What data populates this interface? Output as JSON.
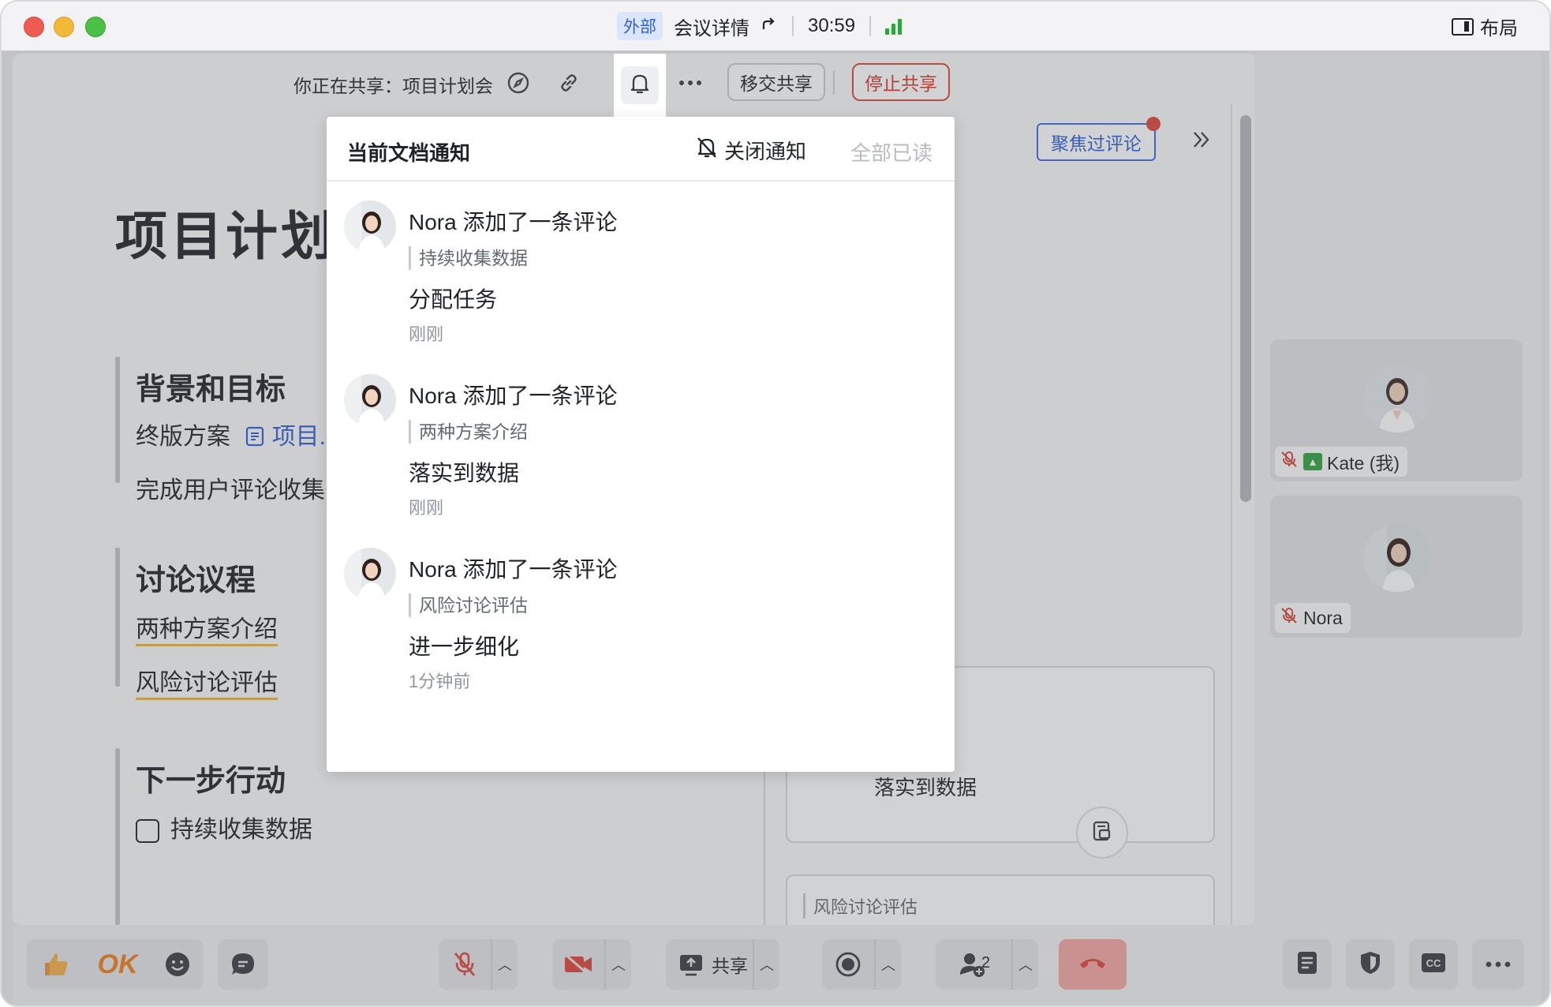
{
  "titlebar": {
    "tag": "外部",
    "meeting_details": "会议详情",
    "timer": "30:59",
    "layout_label": "布局"
  },
  "sharebar": {
    "sharing_text": "你正在共享：项目计划会",
    "transfer_label": "移交共享",
    "stop_label": "停止共享"
  },
  "doc": {
    "title": "项目计划",
    "sections": [
      {
        "heading": "背景和目标",
        "lines": [
          "终版方案",
          "完成用户评论收集"
        ],
        "link": "项目..."
      },
      {
        "heading": "讨论议程",
        "lines": [
          "两种方案介绍",
          "风险讨论评估"
        ]
      },
      {
        "heading": "下一步行动",
        "lines": [
          "持续收集数据"
        ]
      }
    ]
  },
  "comments_panel": {
    "focus_label": "聚焦过评论",
    "card1_text": "落实到数据",
    "card2_quote": "风险讨论评估"
  },
  "popup": {
    "title": "当前文档通知",
    "mute_label": "关闭通知",
    "read_all_label": "全部已读",
    "notifications": [
      {
        "title": "Nora 添加了一条评论",
        "quote": "持续收集数据",
        "body": "分配任务",
        "time": "刚刚"
      },
      {
        "title": "Nora 添加了一条评论",
        "quote": "两种方案介绍",
        "body": "落实到数据",
        "time": "刚刚"
      },
      {
        "title": "Nora 添加了一条评论",
        "quote": "风险讨论评估",
        "body": "进一步细化",
        "time": "1分钟前"
      }
    ]
  },
  "participants": [
    {
      "name": "Kate (我)",
      "muted": true,
      "sharing": true
    },
    {
      "name": "Nora",
      "muted": true,
      "sharing": false
    }
  ],
  "bottom": {
    "ok_label": "OK",
    "share_label": "共享",
    "participant_count": "2"
  },
  "colors": {
    "accent": "#2f5fd9",
    "danger": "#e0443a",
    "signal": "#2fa43f"
  }
}
